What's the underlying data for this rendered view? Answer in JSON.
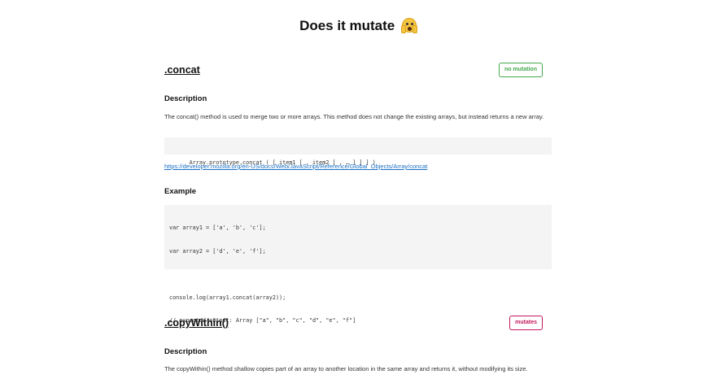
{
  "page": {
    "title": "Does it mutate",
    "emoji": "😱"
  },
  "sections": [
    {
      "name": ".concat",
      "badge": "no mutation",
      "description_heading": "Description",
      "description": "The concat() method is used to merge two or more arrays. This method does not change the existing arrays, but instead returns a new array.",
      "signature": "Array.prototype.concat ( [ item1 [ , item2 [ , … ] ] ] )",
      "link": "https://developer.mozilla.org/en-US/docs/Web/JavaScript/Reference/Global_Objects/Array/concat",
      "example_heading": "Example",
      "example_lines": [
        "var array1 = ['a', 'b', 'c'];",
        "var array2 = ['d', 'e', 'f'];",
        "",
        "console.log(array1.concat(array2));",
        "// expected output: Array [\"a\", \"b\", \"c\", \"d\", \"e\", \"f\"]"
      ]
    },
    {
      "name": ".copyWithin()",
      "badge": "mutates",
      "description_heading": "Description",
      "description": "The copyWithin() method shallow copies part of an array to another location in the same array and returns it, without modifying its size."
    }
  ],
  "colors": {
    "no_mutation": "#46a84b",
    "mutates": "#c2185b",
    "link": "#1a6fc4",
    "code_bg": "#f4f4f4"
  }
}
